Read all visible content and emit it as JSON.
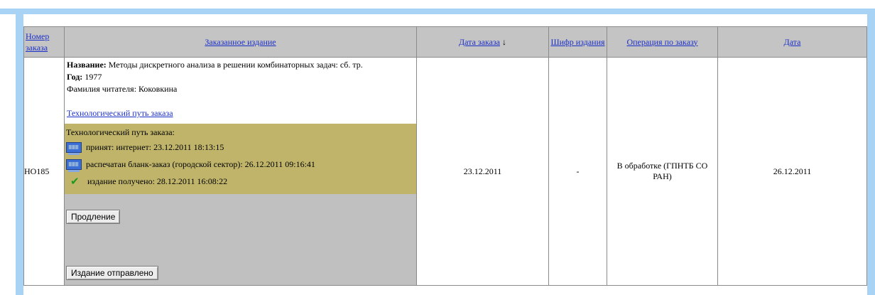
{
  "table": {
    "headers": {
      "number": "Номер заказа",
      "item": "Заказанное издание",
      "order_date": "Дата заказа",
      "sort_indicator": "↓",
      "code": "Шифр издания",
      "operation": "Операция по заказу",
      "date": "Дата"
    },
    "row": {
      "number": "НО185",
      "title_label": "Название:",
      "title": "Методы дискретного анализа в решении комбинаторных задач: сб. тр.",
      "year_label": "Год:",
      "year": "1977",
      "reader": "Фамилия читателя: Коковкина",
      "path_link": "Технологический путь заказа",
      "track_title": "Технологический путь заказа:",
      "track": [
        {
          "icon": "computer-icon",
          "text": "принят: интернет: 23.12.2011 18:13:15"
        },
        {
          "icon": "computer-icon",
          "text": "распечатан бланк-заказ (городской сектор): 26.12.2011 09:16:41"
        },
        {
          "icon": "checkmark-icon",
          "text": "издание получено: 28.12.2011 16:08:22"
        }
      ],
      "btn_extend": "Продление",
      "btn_sent": "Издание отправлено",
      "order_date": "23.12.2011",
      "code": "-",
      "operation": "В обработке (ГПНТБ СО РАН)",
      "date": "26.12.2011"
    }
  },
  "colors": {
    "frame": "#a9d3f5",
    "header_bg": "#c4c4c4",
    "track_bg": "#bfb46a",
    "link": "#1b2fc9"
  }
}
